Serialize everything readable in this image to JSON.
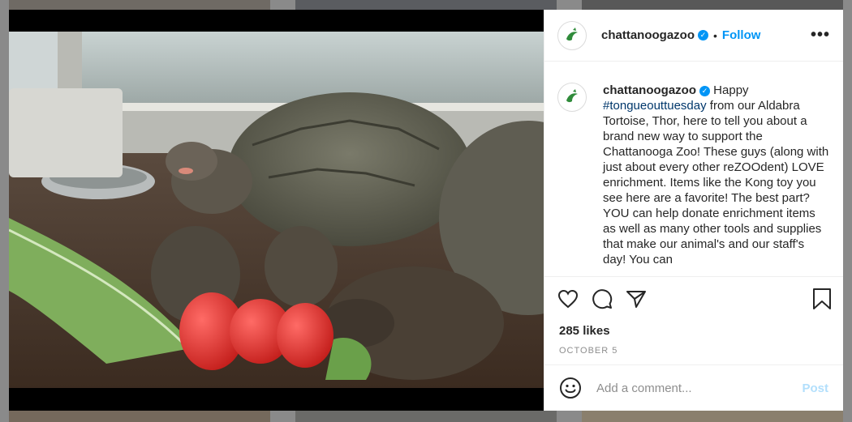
{
  "post": {
    "username": "chattanoogazoo",
    "follow_label": "Follow",
    "more_label": "•••",
    "separator": "•",
    "caption": {
      "username": "chattanoogazoo",
      "first_word": "Happy",
      "hashtag": "#tongueouttuesday",
      "body": "from our Aldabra Tortoise, Thor, here to tell you about a brand new way to support the Chattanooga Zoo! These guys (along with just about every other reZOOdent) LOVE enrichment. Items like the Kong toy you see here are a favorite! The best part? YOU can help donate enrichment items as well as many other tools and supplies that make our animal's and our staff's day! You can"
    },
    "likes": "285 likes",
    "date": "OCTOBER 5",
    "comment": {
      "placeholder": "Add a comment...",
      "post_label": "Post"
    },
    "icons": [
      "heart-icon",
      "comment-icon",
      "share-icon",
      "bookmark-icon",
      "emoji-icon",
      "verified-icon"
    ]
  },
  "colors": {
    "accent": "#0095f6",
    "hashtag": "#00376b",
    "post_disabled": "#b2dffc",
    "muted": "#8e8e8e"
  }
}
